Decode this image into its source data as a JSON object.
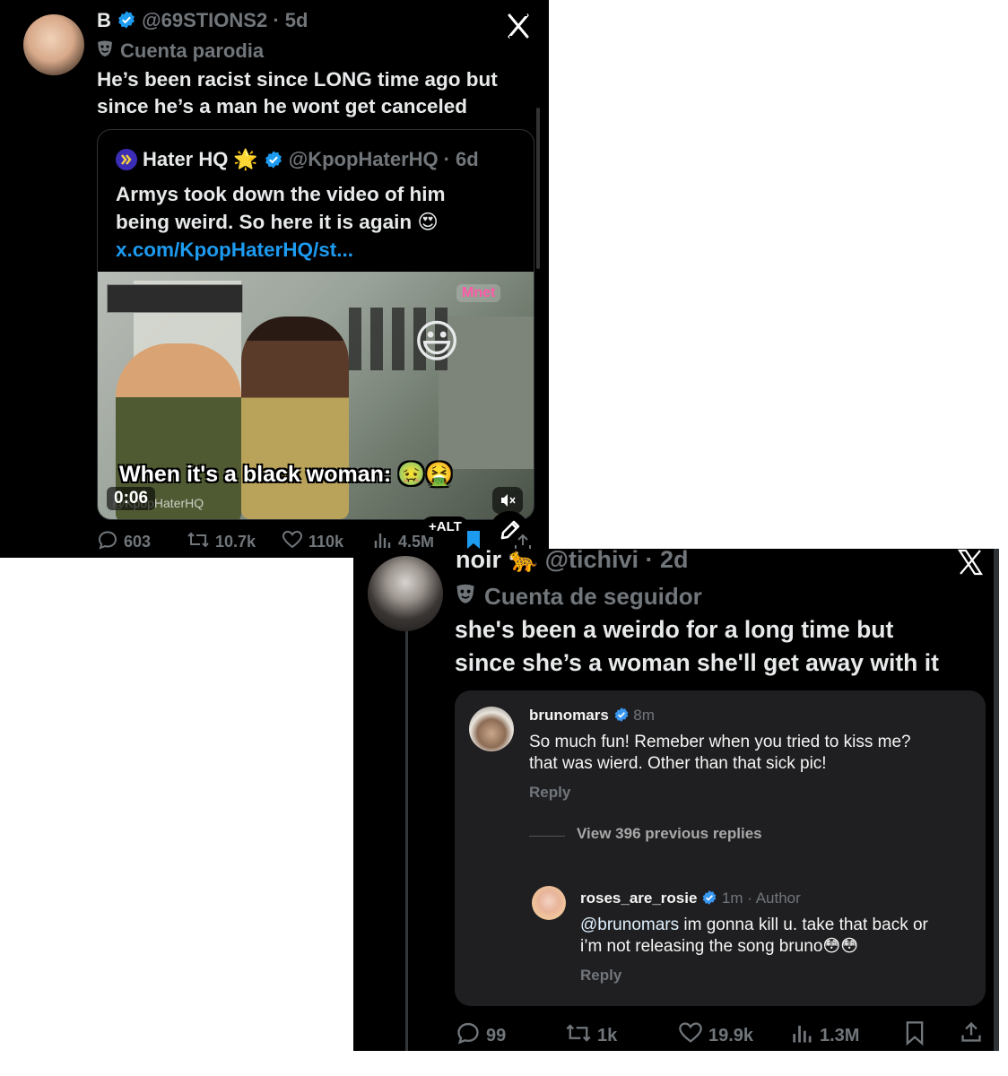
{
  "tweet1": {
    "display_name": "B",
    "handle": "@69STIONS2",
    "time": "5d",
    "label": "Cuenta parodia",
    "text_line1": "He’s been racist since LONG time ago but",
    "text_line2": "since he’s a man he wont get canceled",
    "quote": {
      "name": "Hater HQ",
      "name_emoji": "🌟",
      "handle": "@KpopHaterHQ",
      "time": "6d",
      "text_line1": "Armys took down the video of him",
      "text_line2": "being weird. So here it is again 😍",
      "link": "x.com/KpopHaterHQ/st..."
    },
    "video": {
      "caption": "When it's a black woman: 🤢🤮",
      "timestamp": "0:06",
      "watermark": "@KpopHaterHQ",
      "logo": "Mnet",
      "smiley": "😃",
      "alt_badge": "+ALT"
    },
    "stats": {
      "replies": "603",
      "reposts": "10.7k",
      "likes": "110k",
      "views": "4.5M"
    },
    "icons": {
      "close": "x-logo-close-icon",
      "edit": "pencil-icon"
    }
  },
  "tweet2": {
    "display_name": "noir",
    "name_emoji": "🐆",
    "handle": "@tichivi",
    "time": "2d",
    "label": "Cuenta de seguidor",
    "text_line1": "she's been a weirdo for a long time but",
    "text_line2": "since she’s a woman she'll get away with it",
    "instagram": {
      "comment1": {
        "user": "brunomars",
        "time": "8m",
        "text_line1": "So much fun! Remeber when you tried to kiss me?",
        "text_line2": "that was wierd. Other than that sick pic!",
        "reply": "Reply"
      },
      "view_previous": "View 396 previous replies",
      "comment2": {
        "user": "roses_are_rosie",
        "time": "1m",
        "tag": "Author",
        "mention": "@brunomars",
        "text_line1": " im gonna kill u. take that back or",
        "text_line2": "i’m not releasing the song bruno😳😳",
        "reply": "Reply"
      }
    },
    "stats": {
      "replies": "99",
      "reposts": "1k",
      "likes": "19.9k",
      "views": "1.3M"
    }
  },
  "colors": {
    "background": "#000000",
    "text": "#e7e9ea",
    "muted": "#71767b",
    "link": "#1d9bf0",
    "verified": "#1d9bf0",
    "instagram_card": "#1f1f21"
  }
}
